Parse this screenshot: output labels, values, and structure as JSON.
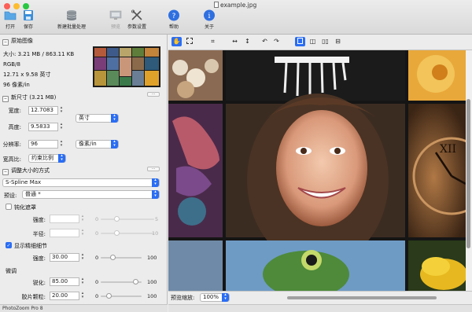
{
  "window": {
    "title": "example.jpg"
  },
  "toolbar": {
    "open": "打开",
    "save": "保存",
    "batch": "新建批量处理",
    "preview": "预览",
    "settings": "参数设置",
    "help": "帮助",
    "about": "关于"
  },
  "original": {
    "title": "原始图像",
    "size": "大小: 3.21 MB / 863.11 KB",
    "mode": "RGB/8",
    "dims": "12.71 x 9.58 英寸",
    "res": "96 像素/in"
  },
  "newsize": {
    "title": "新尺寸 (3.21 MB)",
    "width_label": "宽度:",
    "width_value": "12.7083",
    "height_label": "高度:",
    "height_value": "9.5833",
    "unit": "英寸",
    "resolution_label": "分辨率:",
    "resolution_value": "96",
    "res_unit": "像素/in",
    "aspect_label": "宽高比:",
    "aspect_value": "约束比例"
  },
  "method": {
    "title": "调整大小的方式",
    "algorithm": "S-Spline Max",
    "preset_label": "预设:",
    "preset_value": "普通 *",
    "sharpen_mask": "钝化遮罩",
    "strength_label": "强度:",
    "strength_min": "0",
    "strength_max": "5",
    "radius_label": "半径:",
    "radius_min": "0",
    "radius_max": "10",
    "fine_detail": "显示精细细节",
    "fd_strength_label": "强度:",
    "fd_strength_value": "30.00",
    "fd_min": "0",
    "fd_max": "100",
    "micro": "微调",
    "sharpen_label": "锐化:",
    "sharpen_value": "85.00",
    "sharpen_min": "0",
    "sharpen_max": "100",
    "grain_label": "胶片颗粒:",
    "grain_value": "20.00",
    "grain_min": "0",
    "grain_max": "100"
  },
  "status": {
    "app": "PhotoZoom Pro 8"
  },
  "view": {
    "zoom_label": "预览缩放:",
    "zoom_value": "100%"
  },
  "levels": {
    "fd_strength": 0.3,
    "sharpen": 0.85,
    "grain": 0.2,
    "strength": 0.3,
    "radius": 0.3
  },
  "colors": {
    "accent": "#2a6df4"
  }
}
